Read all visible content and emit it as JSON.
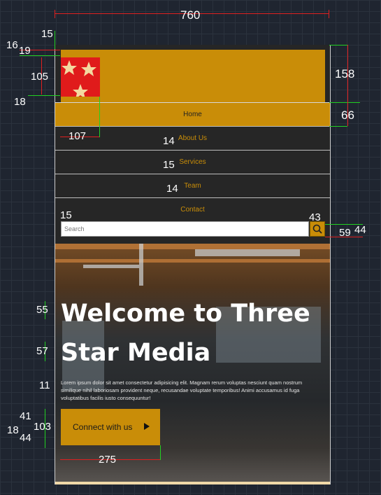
{
  "site": {
    "logo_alt": "three-star logo",
    "nav": [
      {
        "label": "Home",
        "active": true
      },
      {
        "label": "About Us",
        "active": false
      },
      {
        "label": "Services",
        "active": false
      },
      {
        "label": "Team",
        "active": false
      },
      {
        "label": "Contact",
        "active": false
      }
    ],
    "search": {
      "placeholder": "Search"
    },
    "hero": {
      "title": "Welcome to Three Star Media",
      "text": "Lorem ipsum dolor sit amet consectetur adipisicing elit. Magnam rerum voluptas nesciunt quam nostrum similique nihil laboriosam provident neque, recusandae voluptate temporibus! Animi accusamus id fuga voluptatibus facilis iusto consequuntur!",
      "cta_label": "Connect with us"
    }
  },
  "annotations": {
    "page_width": "760",
    "header_top_margin": "15",
    "logo_offset_a": "16",
    "logo_offset_b": "19",
    "logo_height": "105",
    "logo_gap": "18",
    "logo_width": "107",
    "header_height": "158",
    "nav_height": "66",
    "nav_font_about": "14",
    "nav_font_services": "15",
    "nav_font_team": "14",
    "search_margin": "15",
    "search_btn_width": "43",
    "search_btn_area": "59",
    "search_height": "44",
    "title_font_1": "55",
    "title_font_2": "57",
    "text_font": "11",
    "cta_pad_top": "41",
    "cta_text": "18",
    "cta_height": "103",
    "cta_pad_bottom": "44",
    "cta_width": "275"
  },
  "colors": {
    "accent": "#c98d08",
    "logo_red": "#e01b1b",
    "nav_bg": "#262626",
    "annotation_red": "#e02020",
    "annotation_green": "#22d022"
  }
}
